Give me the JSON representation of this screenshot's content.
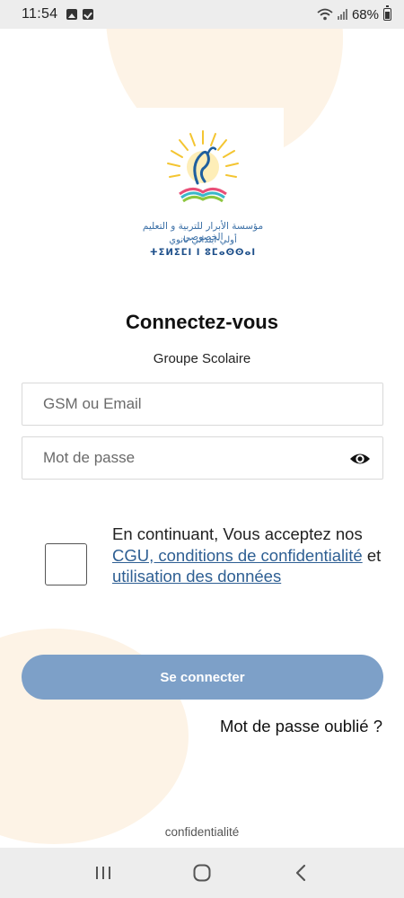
{
  "status_bar": {
    "time": "11:54",
    "battery": "68%",
    "notification_icons": [
      "image-icon",
      "check-icon"
    ]
  },
  "logo": {
    "arabic_line1": "مؤسسة الأبرار للتربية و التعليم الخصوصي",
    "arabic_line2": "أولي-ابتدائي-ثانوي",
    "tifinagh_line": "ⵜⵉⵍⵉⵎⵏ ⵏ ⵓⵎⴰⵙⵙⴰⵏ"
  },
  "login": {
    "title": "Connectez-vous",
    "subtitle": "Groupe Scolaire",
    "login_placeholder": "GSM ou Email",
    "password_placeholder": "Mot de passe",
    "consent_prefix": "En continuant, Vous acceptez nos ",
    "consent_link_cgu": "CGU, conditions de confidentialité",
    "consent_and": " et ",
    "consent_link_usage": "utilisation des données",
    "connect_label": "Se connecter",
    "forgot_label": "Mot de passe oublié ?"
  },
  "footer": {
    "privacy_label": "confidentialité"
  },
  "colors": {
    "button": "#7da0c8",
    "link": "#2e5f93",
    "blob": "#fdf3e6"
  }
}
